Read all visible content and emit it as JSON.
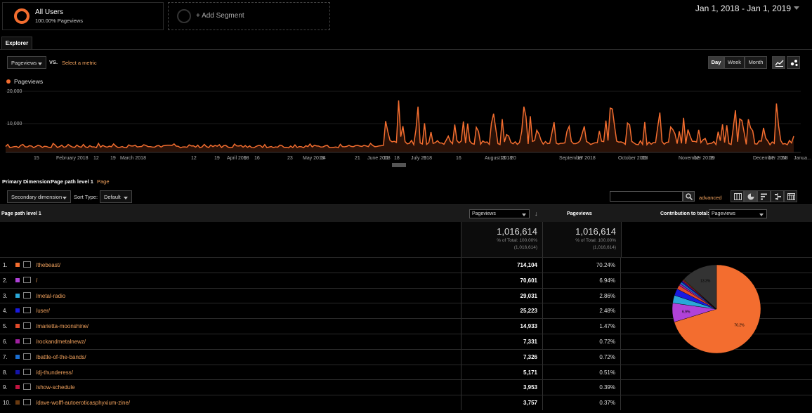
{
  "segments": {
    "all_users": {
      "title": "All Users",
      "subtitle": "100.00% Pageviews"
    },
    "add_label": "+ Add Segment"
  },
  "date_range": "Jan 1, 2018 - Jan 1, 2019",
  "tab": "Explorer",
  "metric_picker": {
    "primary": "Pageviews",
    "vs": "VS.",
    "select_metric": "Select a metric"
  },
  "granularity": {
    "day": "Day",
    "week": "Week",
    "month": "Month",
    "active": "Day"
  },
  "chart": {
    "legend": "Pageviews",
    "yticks": [
      "20,000",
      "10,000"
    ],
    "xticks": [
      "15",
      "February 2018",
      "12",
      "19",
      "March 2018",
      "12",
      "19",
      "April 2018",
      "9",
      "16",
      "23",
      "May 2018",
      "14",
      "21",
      "June 2018",
      "11",
      "18",
      "July 2018",
      "9",
      "16",
      "August 2018",
      "13",
      "20",
      "September 2018",
      "17",
      "October 2018",
      "15",
      "November 2018",
      "12",
      "19",
      "December 2018",
      "17",
      "24",
      "Janua..."
    ]
  },
  "chart_data": {
    "type": "line",
    "title": "",
    "series": [
      {
        "name": "Pageviews",
        "description_of_shape": ""
      }
    ],
    "ylim": [
      0,
      20000
    ],
    "y_ticks": [
      10000,
      20000
    ],
    "x_start": "2018-01-01",
    "x_end": "2019-01-01",
    "peaks": [
      {
        "date": "2018-07-02",
        "value": 17000
      },
      {
        "date": "2018-07-11",
        "value": 15000
      },
      {
        "date": "2018-08-29",
        "value": 15000
      },
      {
        "date": "2018-10-08",
        "value": 14500
      },
      {
        "date": "2018-12-24",
        "value": 16000
      }
    ],
    "grid": false
  },
  "primary_dimension": {
    "label": "Primary Dimension:",
    "value": "Page path level 1",
    "alt": "Page"
  },
  "controls": {
    "secondary_dimension": "Secondary dimension",
    "sort_type_label": "Sort Type:",
    "sort_type_value": "Default",
    "search_value": "",
    "advanced": "advanced"
  },
  "table": {
    "dimension_header": "Page path level 1",
    "metric_select": "Pageviews",
    "metric_header": "Pageviews",
    "contribution_label": "Contribution to total:",
    "contribution_select": "Pageviews",
    "totals": [
      {
        "value": "1,016,614",
        "pct": "% of Total: 100.00%",
        "abs": "(1,016,614)"
      },
      {
        "value": "1,016,614",
        "pct": "% of Total: 100.00%",
        "abs": "(1,016,614)"
      }
    ],
    "rows": [
      {
        "idx": "1.",
        "color": "#f36d2f",
        "path": "/thebeast/",
        "pageviews": "714,104",
        "share": "70.24%"
      },
      {
        "idx": "2.",
        "color": "#b042d8",
        "path": "/",
        "pageviews": "70,601",
        "share": "6.94%"
      },
      {
        "idx": "3.",
        "color": "#2aa7d8",
        "path": "/metal-radio",
        "pageviews": "29,031",
        "share": "2.86%"
      },
      {
        "idx": "4.",
        "color": "#1a1ae0",
        "path": "/user/",
        "pageviews": "25,223",
        "share": "2.48%"
      },
      {
        "idx": "5.",
        "color": "#e04a2a",
        "path": "/marietta-moonshine/",
        "pageviews": "14,933",
        "share": "1.47%"
      },
      {
        "idx": "6.",
        "color": "#a020a0",
        "path": "/rockandmetalnewz/",
        "pageviews": "7,331",
        "share": "0.72%"
      },
      {
        "idx": "7.",
        "color": "#1a6ed0",
        "path": "/battle-of-the-bands/",
        "pageviews": "7,326",
        "share": "0.72%"
      },
      {
        "idx": "8.",
        "color": "#1414a8",
        "path": "/dj-thunderess/",
        "pageviews": "5,171",
        "share": "0.51%"
      },
      {
        "idx": "9.",
        "color": "#c01440",
        "path": "/show-schedule",
        "pageviews": "3,953",
        "share": "0.39%"
      },
      {
        "idx": "10.",
        "color": "#6a3a10",
        "path": "/dave-wolff-autoeroticasphyxium-zine/",
        "pageviews": "3,757",
        "share": "0.37%"
      }
    ],
    "pie": {
      "other_color": "#333333",
      "labels": {
        "first": "70.2%",
        "second": "6.9%",
        "other": "13.3%"
      },
      "other_share": 13.3
    }
  }
}
